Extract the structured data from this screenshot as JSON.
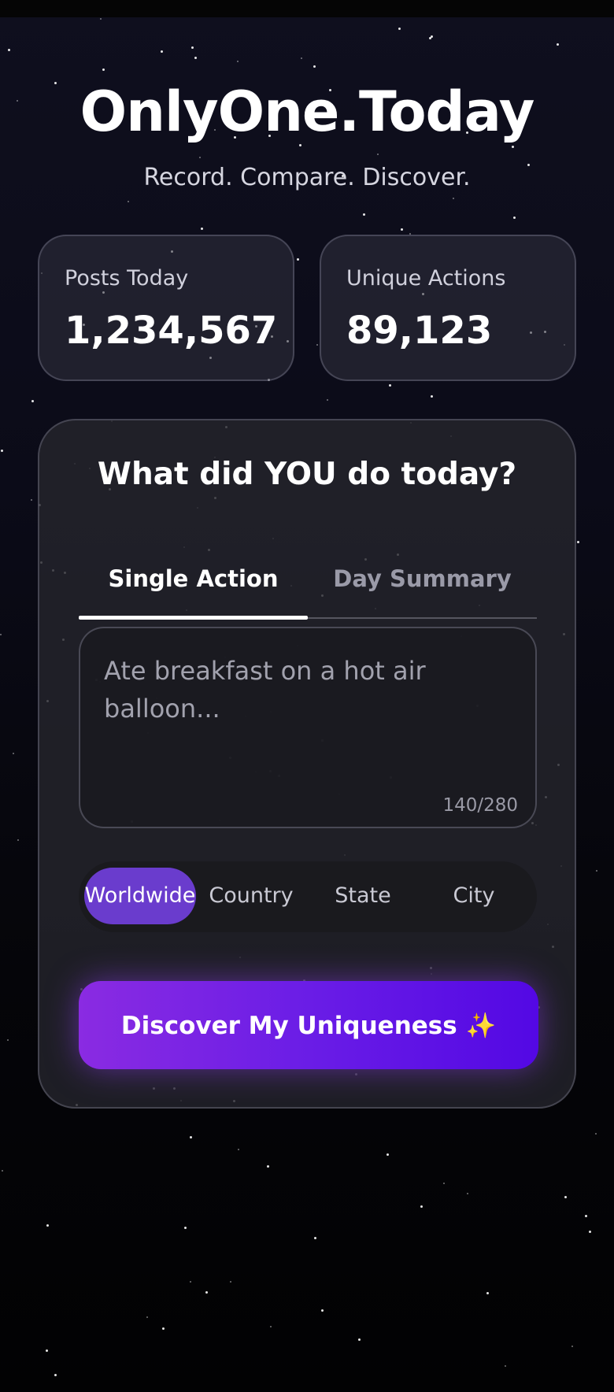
{
  "header": {
    "title": "OnlyOne.Today",
    "subtitle": "Record. Compare. Discover."
  },
  "stats": [
    {
      "label": "Posts Today",
      "value": "1,234,567"
    },
    {
      "label": "Unique Actions",
      "value": "89,123"
    }
  ],
  "composer": {
    "title": "What did YOU do today?",
    "tabs": [
      {
        "label": "Single Action",
        "active": true
      },
      {
        "label": "Day Summary",
        "active": false
      }
    ],
    "input": {
      "placeholder": "Ate breakfast on a hot air balloon...",
      "value": "",
      "counter": "140/280"
    },
    "scope_options": [
      {
        "label": "Worldwide",
        "selected": true
      },
      {
        "label": "Country",
        "selected": false
      },
      {
        "label": "State",
        "selected": false
      },
      {
        "label": "City",
        "selected": false
      }
    ],
    "submit_label": "Discover My Uniqueness",
    "submit_icon": "sparkles-icon"
  },
  "colors": {
    "accent_start": "#8a2be2",
    "accent_end": "#5308e4",
    "scope_selected": "#6a3ccd"
  }
}
